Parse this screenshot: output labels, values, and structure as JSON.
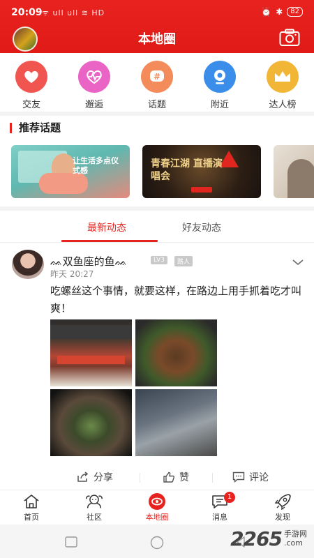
{
  "status_bar": {
    "time": "20:09",
    "left_icons": "ᯤ ull ull ≋ HD",
    "battery": "82"
  },
  "header": {
    "title": "本地圈"
  },
  "categories": [
    {
      "label": "交友",
      "icon": "heart-chat-icon",
      "color": "#f0554f"
    },
    {
      "label": "邂逅",
      "icon": "heartbeat-icon",
      "color": "#e964c4"
    },
    {
      "label": "话题",
      "icon": "hashtag-icon",
      "color": "#f38b5b"
    },
    {
      "label": "附近",
      "icon": "location-icon",
      "color": "#3a8de8"
    },
    {
      "label": "达人榜",
      "icon": "crown-icon",
      "color": "#f2b637"
    }
  ],
  "recommended": {
    "title": "推荐话题",
    "banners": [
      {
        "text": "让生活多点仪式感"
      },
      {
        "text": "青春江湖 直播演唱会"
      }
    ]
  },
  "tabs": [
    {
      "label": "最新动态",
      "active": true
    },
    {
      "label": "好友动态",
      "active": false
    }
  ],
  "post": {
    "name": "ᨐ双鱼座的鱼ᨐ",
    "level": "LV3",
    "role": "路人",
    "time": "昨天 20:27",
    "text": "吃螺丝这个事情，就要这样，在路边上用手抓着吃才叫爽！",
    "actions": {
      "share": "分享",
      "like": "赞",
      "comment": "评论"
    }
  },
  "bottom_nav": [
    {
      "label": "首页",
      "icon": "home-icon",
      "active": false
    },
    {
      "label": "社区",
      "icon": "community-icon",
      "active": false
    },
    {
      "label": "本地圈",
      "icon": "local-circle-icon",
      "active": true
    },
    {
      "label": "消息",
      "icon": "message-icon",
      "active": false,
      "badge": "1"
    },
    {
      "label": "发现",
      "icon": "rocket-icon",
      "active": false
    }
  ],
  "watermark": {
    "number": "2265",
    "suffix": ".com",
    "site": "手游网"
  },
  "colors": {
    "brand_red": "#e8231f"
  }
}
